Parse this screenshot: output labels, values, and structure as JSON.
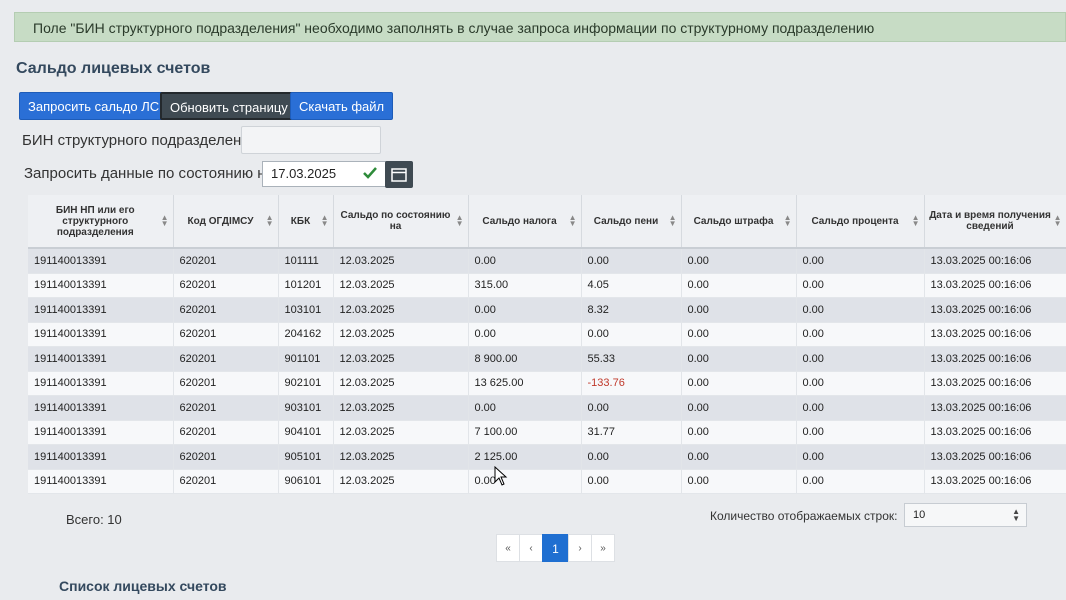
{
  "notice": "Поле \"БИН структурного подразделения\" необходимо заполнять в случае запроса информации по структурному подразделению",
  "section_title": "Сальдо лицевых счетов",
  "toolbar": {
    "request_label": "Запросить сальдо ЛС",
    "refresh_label": "Обновить страницу",
    "download_label": "Скачать файл"
  },
  "form": {
    "bin_label": "БИН структурного подразделения",
    "bin_value": "",
    "date_label": "Запросить данные по состоянию на",
    "date_value": "17.03.2025"
  },
  "table": {
    "columns": [
      "БИН НП или его структурного подразделения",
      "Код ОГДІМСУ",
      "КБК",
      "Сальдо по состоянию на",
      "Сальдо налога",
      "Сальдо пени",
      "Сальдо штрафа",
      "Сальдо процента",
      "Дата и время получения сведений"
    ],
    "rows": [
      [
        "191140013391",
        "620201",
        "101111",
        "12.03.2025",
        "0.00",
        "0.00",
        "0.00",
        "0.00",
        "13.03.2025 00:16:06"
      ],
      [
        "191140013391",
        "620201",
        "101201",
        "12.03.2025",
        "315.00",
        "4.05",
        "0.00",
        "0.00",
        "13.03.2025 00:16:06"
      ],
      [
        "191140013391",
        "620201",
        "103101",
        "12.03.2025",
        "0.00",
        "8.32",
        "0.00",
        "0.00",
        "13.03.2025 00:16:06"
      ],
      [
        "191140013391",
        "620201",
        "204162",
        "12.03.2025",
        "0.00",
        "0.00",
        "0.00",
        "0.00",
        "13.03.2025 00:16:06"
      ],
      [
        "191140013391",
        "620201",
        "901101",
        "12.03.2025",
        "8 900.00",
        "55.33",
        "0.00",
        "0.00",
        "13.03.2025 00:16:06"
      ],
      [
        "191140013391",
        "620201",
        "902101",
        "12.03.2025",
        "13 625.00",
        "-133.76",
        "0.00",
        "0.00",
        "13.03.2025 00:16:06"
      ],
      [
        "191140013391",
        "620201",
        "903101",
        "12.03.2025",
        "0.00",
        "0.00",
        "0.00",
        "0.00",
        "13.03.2025 00:16:06"
      ],
      [
        "191140013391",
        "620201",
        "904101",
        "12.03.2025",
        "7 100.00",
        "31.77",
        "0.00",
        "0.00",
        "13.03.2025 00:16:06"
      ],
      [
        "191140013391",
        "620201",
        "905101",
        "12.03.2025",
        "2 125.00",
        "0.00",
        "0.00",
        "0.00",
        "13.03.2025 00:16:06"
      ],
      [
        "191140013391",
        "620201",
        "906101",
        "12.03.2025",
        "0.00",
        "0.00",
        "0.00",
        "0.00",
        "13.03.2025 00:16:06"
      ]
    ]
  },
  "footer": {
    "total": "Всего: 10",
    "rows_label": "Количество отображаемых строк:",
    "rows_value": "10"
  },
  "pagination": {
    "first": "«",
    "prev": "‹",
    "current": "1",
    "next": "›",
    "last": "»"
  },
  "subsection_title": "Список лицевых счетов",
  "colors": {
    "primary": "#2a6fd6",
    "dark_button": "#3f4a52",
    "notice_bg": "#c7dcc5",
    "negative": "#c0392b"
  },
  "icons": [
    "check-icon",
    "calendar-icon",
    "sort-icon",
    "mouse-pointer-icon"
  ]
}
